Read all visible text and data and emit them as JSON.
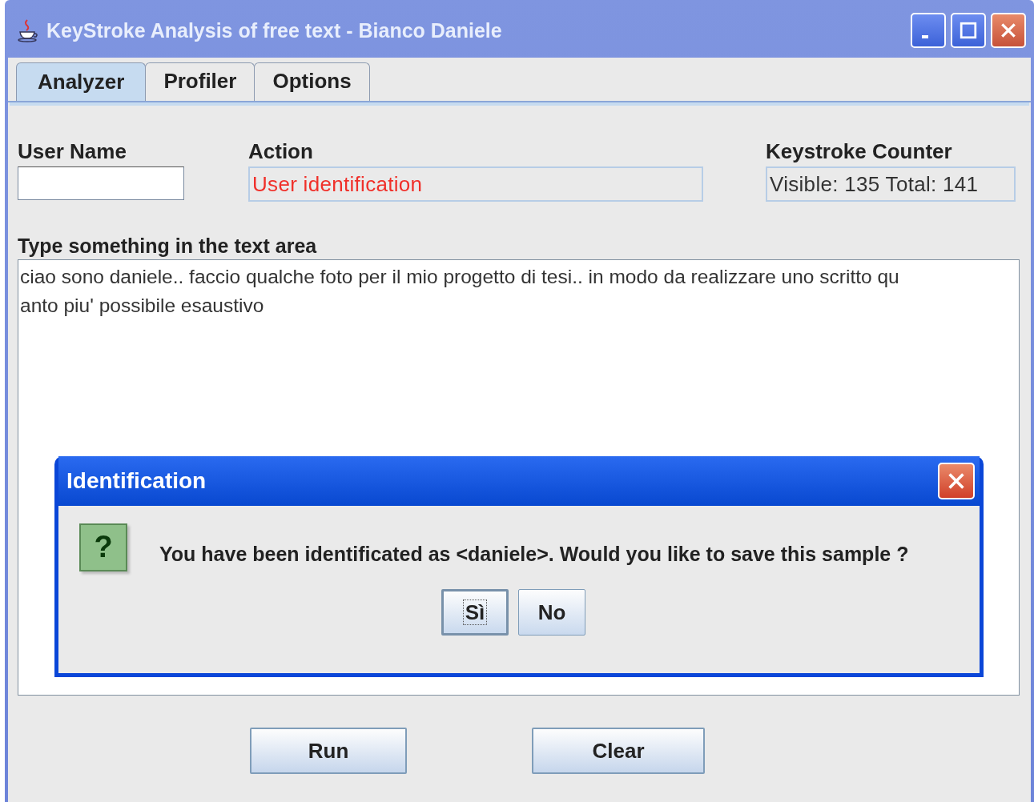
{
  "window": {
    "title": "KeyStroke Analysis of free text - Bianco Daniele"
  },
  "tabs": [
    {
      "label": "Analyzer",
      "selected": true
    },
    {
      "label": "Profiler",
      "selected": false
    },
    {
      "label": "Options",
      "selected": false
    }
  ],
  "user_name": {
    "label": "User Name"
  },
  "action": {
    "label": "Action",
    "value": "User identification"
  },
  "keystroke_counter": {
    "label": "Keystroke Counter",
    "value": "Visible: 135  Total: 141"
  },
  "text_area": {
    "label": "Type something in the text area",
    "lines": [
      "ciao sono daniele.. faccio qualche foto per il mio progetto di tesi.. in modo da realizzare uno scritto qu",
      "anto piu' possibile esaustivo"
    ]
  },
  "dialog": {
    "title": "Identification",
    "icon": "?",
    "message": "You have been identificated as <daniele>. Would you like to save this sample ?",
    "buttons": [
      {
        "label": "Sì",
        "focused": true
      },
      {
        "label": "No",
        "focused": false
      }
    ]
  },
  "buttons": [
    "Run",
    "Clear"
  ]
}
